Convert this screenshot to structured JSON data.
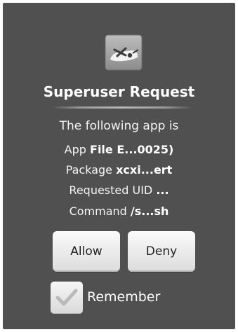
{
  "dialog": {
    "title": "Superuser Request",
    "intro": "The following app is",
    "app_label": "App",
    "app_value": "File E...0025)",
    "package_label": "Package",
    "package_value": "xcxi...ert",
    "uid_label": "Requested UID",
    "uid_value": "...",
    "command_label": "Command",
    "command_value": "/s...sh",
    "icon": "superuser-pirate-icon"
  },
  "buttons": {
    "allow_label": "Allow",
    "deny_label": "Deny"
  },
  "remember": {
    "label": "Remember",
    "checked": true
  },
  "colors": {
    "dialog_background": "#505050",
    "text": "#ffffff",
    "button_background": "#ececec"
  }
}
